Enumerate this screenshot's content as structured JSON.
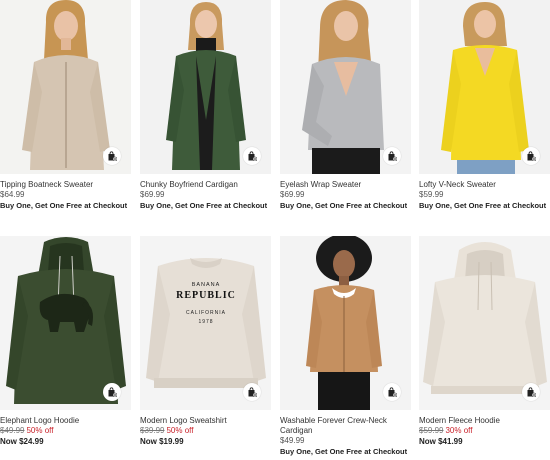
{
  "products": [
    {
      "name": "Tipping Boatneck Sweater",
      "price": "$64.99",
      "promo": "Buy One, Get One Free at Checkout"
    },
    {
      "name": "Chunky Boyfriend Cardigan",
      "price": "$69.99",
      "promo": "Buy One, Get One Free at Checkout"
    },
    {
      "name": "Eyelash Wrap Sweater",
      "price": "$69.99",
      "promo": "Buy One, Get One Free at Checkout"
    },
    {
      "name": "Lofty V-Neck Sweater",
      "price": "$59.99",
      "promo": "Buy One, Get One Free at Checkout"
    },
    {
      "name": "Elephant Logo Hoodie",
      "price": "$49.99",
      "discount": "50% off",
      "now": "Now $24.99"
    },
    {
      "name": "Modern Logo Sweatshirt",
      "price": "$39.99",
      "discount": "50% off",
      "now": "Now $19.99",
      "print": {
        "line1": "BANANA",
        "line2": "REPUBLIC",
        "line3": "CALIFORNIA",
        "line4": "1978"
      }
    },
    {
      "name": "Washable Forever Crew-Neck Cardigan",
      "price": "$49.99",
      "promo": "Buy One, Get One Free at Checkout"
    },
    {
      "name": "Modern Fleece Hoodie",
      "price": "$59.99",
      "discount": "30% off",
      "now": "Now $41.99"
    }
  ],
  "icons": {
    "add_to_bag": "shopping-bag-plus-icon"
  }
}
